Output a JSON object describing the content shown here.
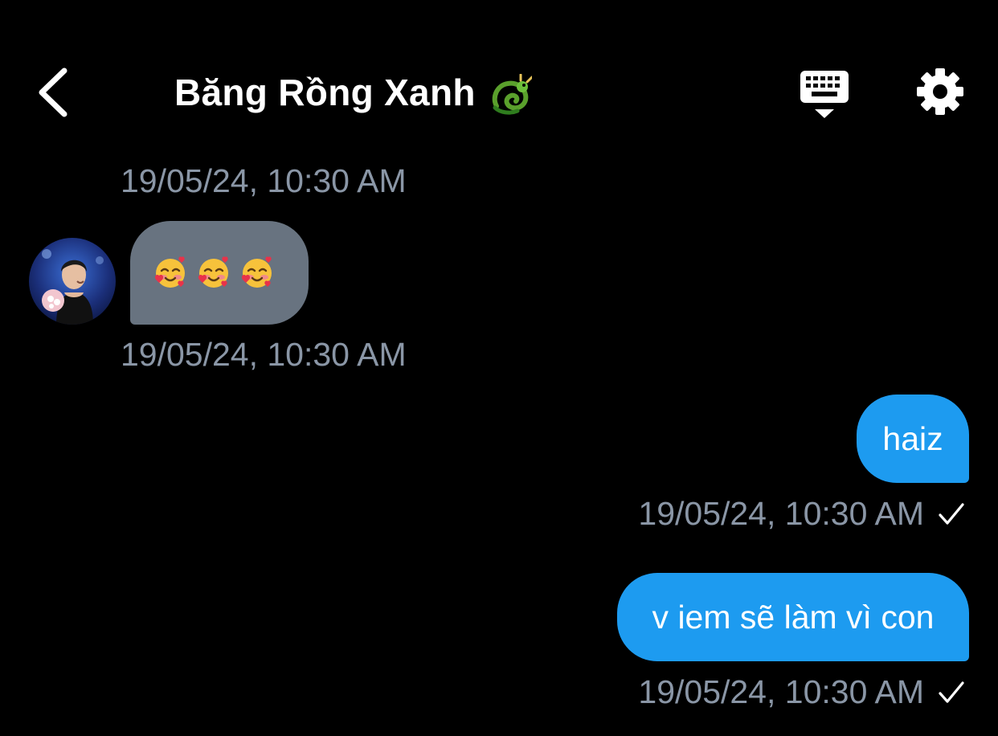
{
  "header": {
    "title": "Băng Rồng Xanh",
    "back_icon": "chevron-left-icon",
    "title_emoji": "dragon-emoji",
    "keyboard_icon": "keyboard-icon",
    "settings_icon": "gear-icon"
  },
  "messages": [
    {
      "direction": "incoming",
      "timestamp_above": "19/05/24, 10:30 AM",
      "emojis": [
        "smiling-face-with-hearts",
        "smiling-face-with-hearts",
        "smiling-face-with-hearts"
      ],
      "timestamp": "19/05/24, 10:30 AM"
    },
    {
      "direction": "outgoing",
      "text": "haiz",
      "timestamp": "19/05/24, 10:30 AM",
      "status_icon": "check-icon"
    },
    {
      "direction": "outgoing",
      "text": "v iem sẽ làm vì con",
      "timestamp": "19/05/24, 10:30 AM",
      "status_icon": "check-icon"
    }
  ],
  "colors": {
    "background": "#000000",
    "incoming_bubble": "#687380",
    "outgoing_bubble": "#1d9bf0",
    "timestamp": "#8a96a6"
  }
}
